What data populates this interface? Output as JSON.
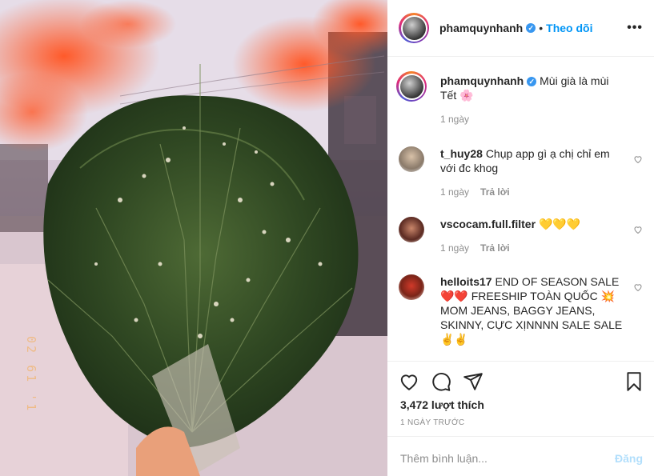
{
  "photo": {
    "film_date": "02 61 '1"
  },
  "header": {
    "username": "phamquynhanh",
    "verified_icon": "verified-badge-icon",
    "follow_label": "Theo dõi",
    "more_icon": "ellipsis-icon"
  },
  "caption": {
    "username": "phamquynhanh",
    "text": "Mùi già là mùi Tết 🌸",
    "time": "1 ngày"
  },
  "comments": [
    {
      "username": "t_huy28",
      "text": "Chụp app gì ạ chị chỉ em với đc khog",
      "time": "1 ngày",
      "reply": "Trả lời"
    },
    {
      "username": "vscocam.full.filter",
      "text": "💛💛💛",
      "time": "1 ngày",
      "reply": "Trả lời"
    },
    {
      "username": "helloits17",
      "text": "END OF SEASON SALE ❤️❤️ FREESHIP TOÀN QUỐC 💥 MOM JEANS, BAGGY JEANS, SKINNY, CỰC XỊNNNN SALE SALE ✌️✌️",
      "time": "",
      "reply": ""
    }
  ],
  "actions": {
    "like_icon": "heart-icon",
    "comment_icon": "comment-icon",
    "share_icon": "send-icon",
    "save_icon": "bookmark-icon",
    "likes": "3,472 lượt thích",
    "timestamp": "1 NGÀY TRƯỚC"
  },
  "add_comment": {
    "placeholder": "Thêm bình luận...",
    "post_label": "Đăng"
  }
}
